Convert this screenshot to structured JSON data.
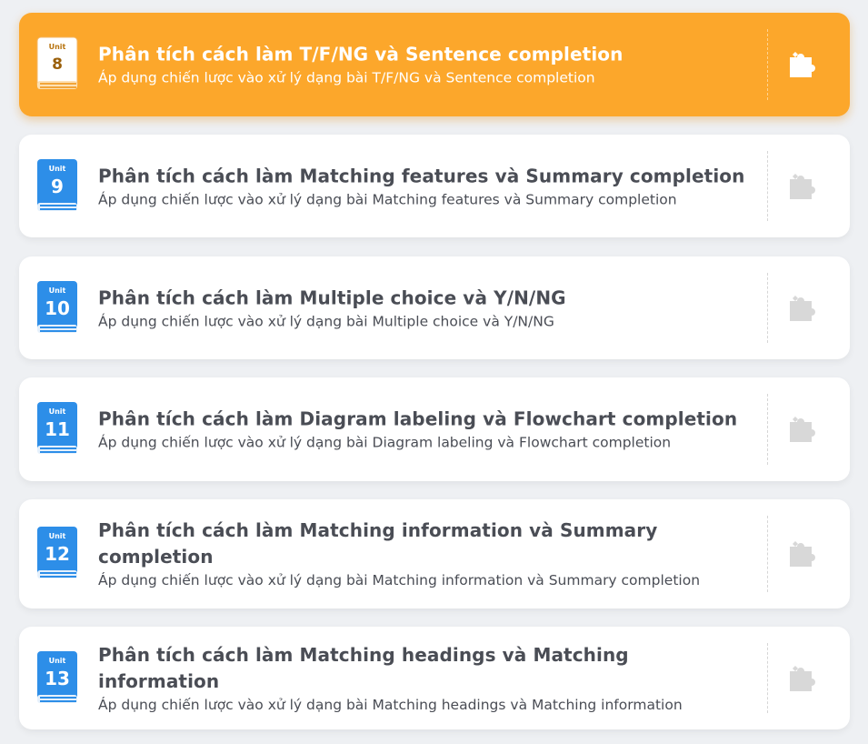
{
  "colors": {
    "active_bg": "#fca72b",
    "card_bg": "#ffffff",
    "book_blue": "#2d8ee8",
    "icon_gray": "#d8d8d8",
    "text": "#4a4d55"
  },
  "units": [
    {
      "unit_label": "Unit",
      "number": "8",
      "title": "Phân tích cách làm T/F/NG và Sentence completion",
      "description": "Áp dụng chiến lược vào xử lý dạng bài T/F/NG và Sentence completion",
      "active": true,
      "action_icon": "puzzle-piece-icon"
    },
    {
      "unit_label": "Unit",
      "number": "9",
      "title": "Phân tích cách làm Matching features và Summary completion",
      "description": "Áp dụng chiến lược vào xử lý dạng bài Matching features và Summary completion",
      "active": false,
      "action_icon": "puzzle-piece-icon"
    },
    {
      "unit_label": "Unit",
      "number": "10",
      "title": "Phân tích cách làm Multiple choice và Y/N/NG",
      "description": "Áp dụng chiến lược vào xử lý dạng bài Multiple choice và Y/N/NG",
      "active": false,
      "action_icon": "puzzle-piece-icon"
    },
    {
      "unit_label": "Unit",
      "number": "11",
      "title": "Phân tích cách làm Diagram labeling và Flowchart completion",
      "description": "Áp dụng chiến lược vào xử lý dạng bài Diagram labeling và Flowchart completion",
      "active": false,
      "action_icon": "puzzle-piece-icon"
    },
    {
      "unit_label": "Unit",
      "number": "12",
      "title": "Phân tích cách làm Matching information và Summary completion",
      "description": "Áp dụng chiến lược vào xử lý dạng bài Matching information và Summary completion",
      "active": false,
      "action_icon": "puzzle-piece-icon"
    },
    {
      "unit_label": "Unit",
      "number": "13",
      "title": "Phân tích cách làm Matching headings và Matching information",
      "description": "Áp dụng chiến lược vào xử lý dạng bài Matching headings và Matching information",
      "active": false,
      "action_icon": "puzzle-piece-icon"
    }
  ]
}
